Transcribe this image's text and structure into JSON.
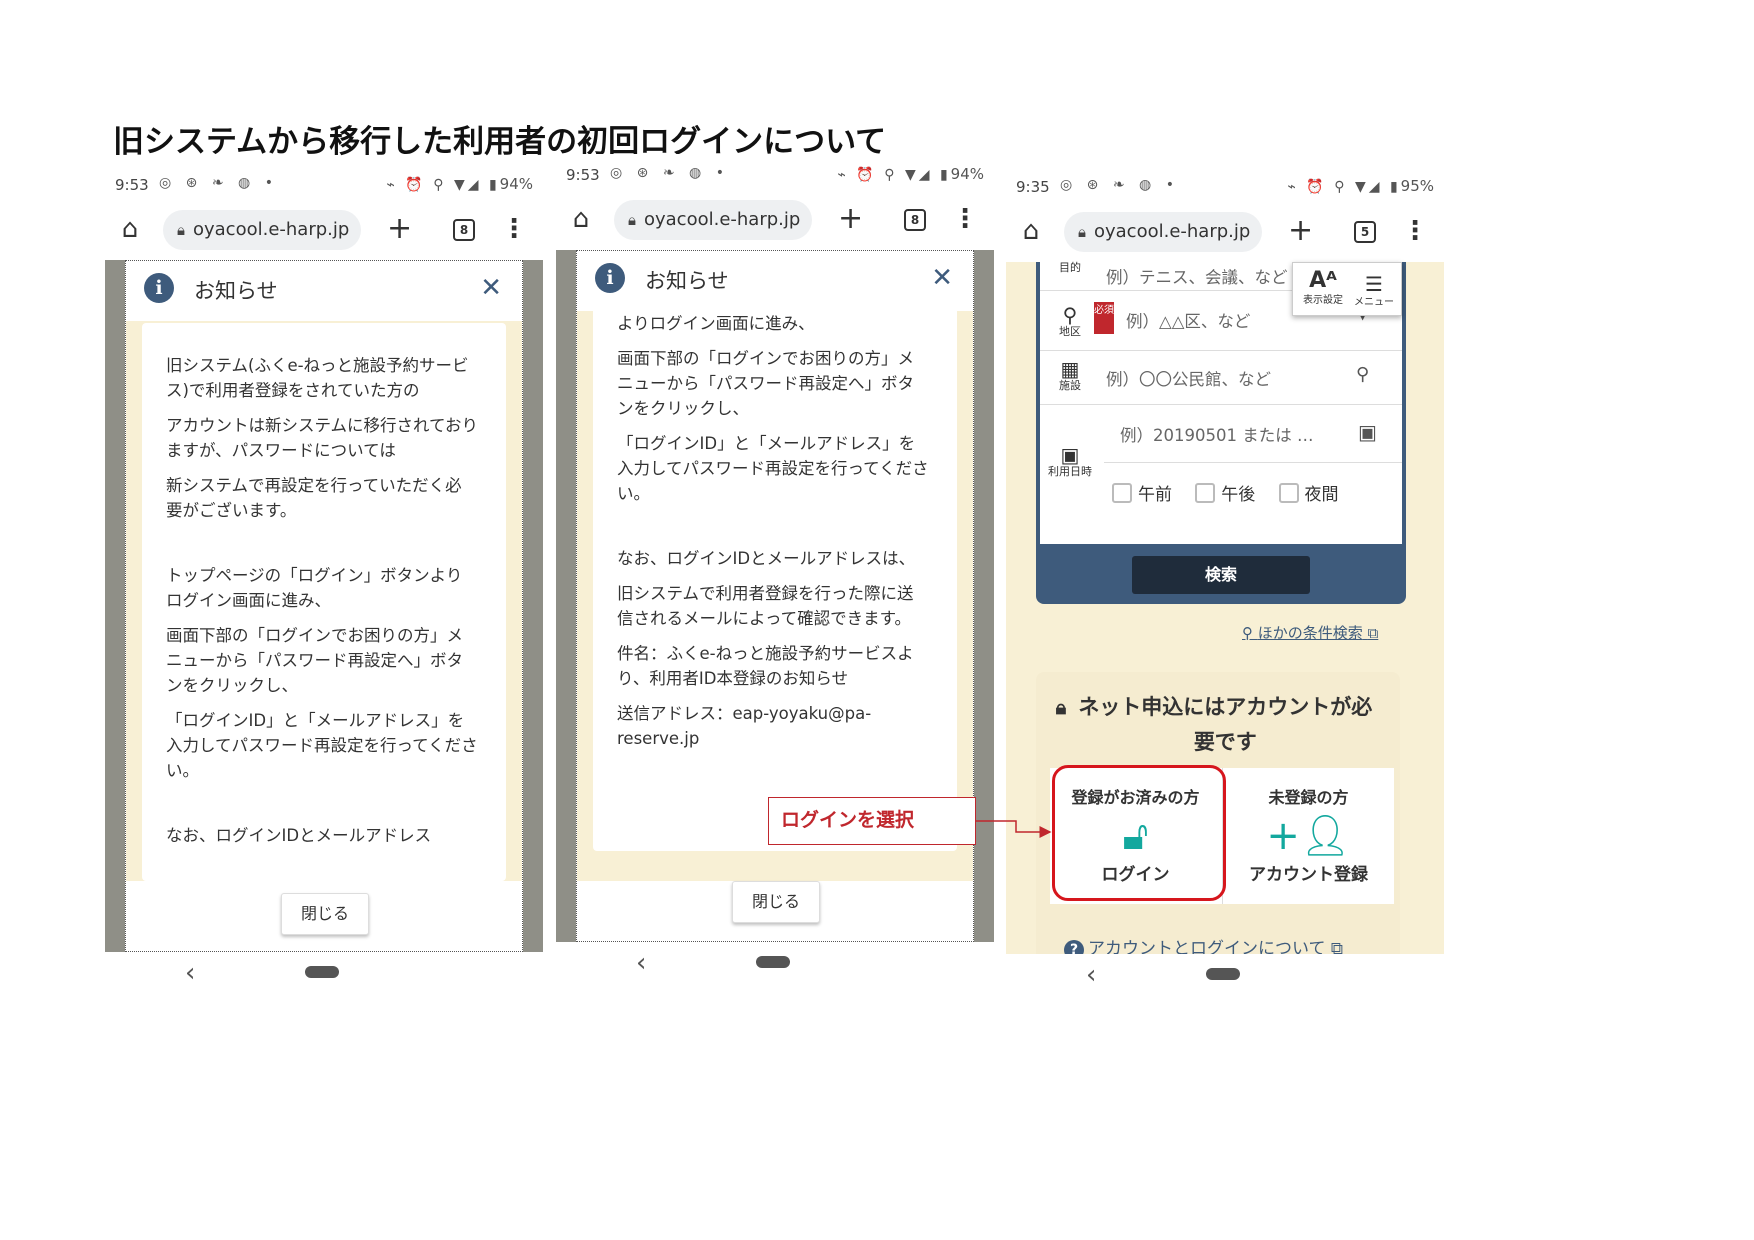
{
  "page": {
    "title": "旧システムから移行した利用者の初回ログインについて"
  },
  "screens": [
    {
      "status": {
        "time": "9:53",
        "battery": "94%"
      },
      "browser": {
        "url": "oyacool.e-harp.jp",
        "tab_count": "8"
      },
      "notice": {
        "title": "お知らせ",
        "paragraphs": [
          "旧システム(ふくe-ねっと施設予約サービス)で利用者登録をされていた方の",
          "アカウントは新システムに移行されておりますが、パスワードについては",
          "新システムで再設定を行っていただく必要がございます。",
          "",
          "トップページの「ログイン」ボタンよりログイン画面に進み、",
          "画面下部の「ログインでお困りの方」メニューから「パスワード再設定へ」ボタンをクリックし、",
          "「ログインID」と「メールアドレス」を入力してパスワード再設定を行ってください。",
          "",
          "なお、ログインIDとメールアドレス"
        ],
        "close_label": "閉じる"
      }
    },
    {
      "status": {
        "time": "9:53",
        "battery": "94%"
      },
      "browser": {
        "url": "oyacool.e-harp.jp",
        "tab_count": "8"
      },
      "notice": {
        "title": "お知らせ",
        "paragraphs": [
          "よりログイン画面に進み、",
          "画面下部の「ログインでお困りの方」メニューから「パスワード再設定へ」ボタンをクリックし、",
          "「ログインID」と「メールアドレス」を入力してパスワード再設定を行ってください。",
          "",
          "なお、ログインIDとメールアドレスは、",
          "旧システムで利用者登録を行った際に送信されるメールによって確認できます。",
          "件名：ふくe-ねっと施設予約サービスより、利用者ID本登録のお知らせ",
          "送信アドレス：eap-yoyaku@pa-reserve.jp"
        ],
        "close_label": "閉じる"
      }
    },
    {
      "status": {
        "time": "9:35",
        "battery": "95%"
      },
      "browser": {
        "url": "oyacool.e-harp.jp",
        "tab_count": "5"
      },
      "search": {
        "purpose_label": "目的",
        "purpose_placeholder": "例）テニス、会議、など",
        "area_label": "地区",
        "required_badge": "必須",
        "area_placeholder": "例）△△区、など",
        "facility_label": "施設",
        "facility_placeholder": "例）〇〇公民館、など",
        "date_label": "利用日時",
        "date_placeholder": "例）20190501 または …",
        "slots": [
          "午前",
          "午後",
          "夜間"
        ],
        "search_button": "検索",
        "display_settings": "表示設定",
        "menu": "メニュー",
        "other_search": "ほかの条件検索"
      },
      "account": {
        "title": "ネット申込にはアカウントが必要です",
        "registered_heading": "登録がお済みの方",
        "login_label": "ログイン",
        "unregistered_heading": "未登録の方",
        "register_label": "アカウント登録",
        "about_link": "アカウントとログインについて"
      }
    }
  ],
  "annotation": {
    "callout": "ログインを選択"
  },
  "colors": {
    "accent": "#3e5b7c",
    "teal": "#13a89e",
    "highlight": "#d6161d",
    "notice_bg": "#f8f0d5"
  }
}
